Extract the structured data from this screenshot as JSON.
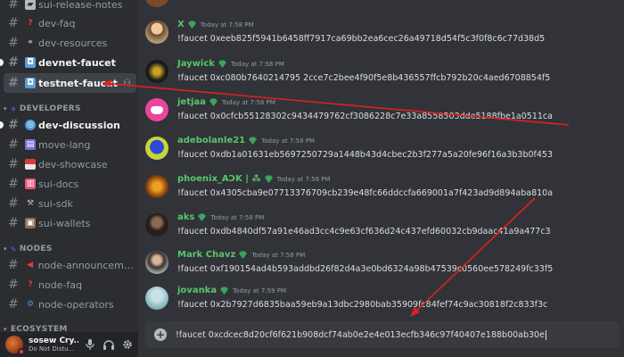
{
  "sidebar": {
    "channels_top": [
      {
        "name": "sui-release-notes",
        "icon": "megaphone-icon"
      },
      {
        "name": "dev-faq",
        "icon": "question-icon"
      },
      {
        "name": "dev-resources",
        "icon": "link-icon"
      },
      {
        "name": "devnet-faucet",
        "icon": "robot-icon"
      },
      {
        "name": "testnet-faucet",
        "icon": "robot-icon"
      }
    ],
    "category_developers": "DEVELOPERS",
    "channels_dev": [
      {
        "name": "dev-discussion",
        "icon": "globe-icon"
      },
      {
        "name": "move-lang",
        "icon": "box-icon"
      },
      {
        "name": "dev-showcase",
        "icon": "flag-icon"
      },
      {
        "name": "sui-docs",
        "icon": "book-icon"
      },
      {
        "name": "sui-sdk",
        "icon": "tools-icon"
      },
      {
        "name": "sui-wallets",
        "icon": "wallet-icon"
      }
    ],
    "category_nodes": "NODES",
    "channels_nodes": [
      {
        "name": "node-announceme...",
        "icon": "megaphone-icon"
      },
      {
        "name": "node-faq",
        "icon": "question-icon"
      },
      {
        "name": "node-operators",
        "icon": "wrench-icon"
      }
    ],
    "category_ecosystem": "ECOSYSTEM"
  },
  "user": {
    "name": "sosew Cry...",
    "status": "Do Not Distu..."
  },
  "messages": [
    {
      "author": "X",
      "time": "Today at 7:58 PM",
      "text": "!faucet 0xeeb825f5941b6458ff7917ca69bb2ea6cec26a49718d54f5c3f0f8c6c77d38d5"
    },
    {
      "author": "Jaywick",
      "time": "Today at 7:58 PM",
      "text": "!faucet 0xc080b7640214795 2cce7c2bee4f90f5e8b436557ffcb792b20c4aed6708854f5"
    },
    {
      "author": "jetjaa",
      "time": "Today at 7:58 PM",
      "text": "!faucet 0x0cfcb55128302c9434479762cf3086228c7e33a8558503dde5188fbe1a0511ca"
    },
    {
      "author": "adebolanle21",
      "time": "Today at 7:58 PM",
      "text": "!faucet 0xdb1a01631eb5697250729a1448b43d4cbec2b3f277a5a20fe96f16a3b3b0f453"
    },
    {
      "author": "phoenix_AƆK | ⁂",
      "time": "Today at 7:58 PM",
      "text": "!faucet 0x4305cba9e07713376709cb239e48fc66ddccfa669001a7f423ad9d894aba810a"
    },
    {
      "author": "aks",
      "time": "Today at 7:58 PM",
      "text": "!faucet 0xdb4840df57a91e46ad3cc4c9e63cf636d24c437efd60032cb9daac41a9a477c3"
    },
    {
      "author": "Mark Chavz",
      "time": "Today at 7:58 PM",
      "text": "!faucet 0xf190154ad4b593addbd26f82d4a3e0bd6324a98b47539c0560ee578249fc33f5"
    },
    {
      "author": "jovanka",
      "time": "Today at 7:59 PM",
      "text": "!faucet 0x2b7927d6835baa59eb9a13dbc2980bab35909fc84fef74c9ac30818f2c833f3c"
    }
  ],
  "input": {
    "value": "!faucet 0xcdcec8d20cf6f621b908dcf74ab0e2e4e013ecfb346c97f40407e188b00ab30e"
  },
  "colors": {
    "username": "#58c76a",
    "annotation_arrow": "#e02020",
    "badge": "#3ba55d"
  }
}
